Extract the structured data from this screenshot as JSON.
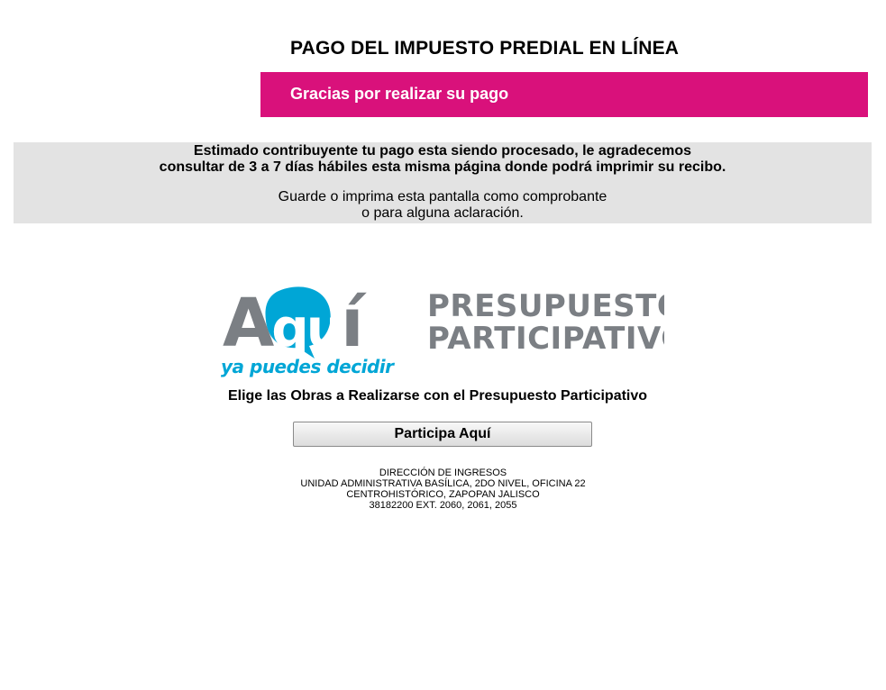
{
  "header": {
    "title": "PAGO DEL IMPUESTO PREDIAL EN LÍNEA",
    "banner_text": "Gracias por realizar su pago",
    "banner_color": "#d9117b"
  },
  "notice": {
    "line1": "Estimado contribuyente tu pago esta siendo procesado, le agradecemos",
    "line2": "consultar de 3 a 7 días hábiles esta misma página donde podrá imprimir su recibo.",
    "line3": "Guarde o imprima esta pantalla como comprobante",
    "line4": "o para alguna aclaración."
  },
  "logo": {
    "word": "Aquí",
    "tagline": "ya puedes decidir",
    "title_line1": "PRESUPUESTO",
    "title_line2": "PARTICIPATIVO",
    "gray": "#7b7f84",
    "blue": "#00a6d6"
  },
  "promo": {
    "heading": "Elige las Obras a Realizarse con el Presupuesto Participativo",
    "button_label": "Participa Aquí"
  },
  "footer": {
    "line1": "DIRECCIÓN DE INGRESOS",
    "line2": "UNIDAD ADMINISTRATIVA BASÍLICA, 2DO NIVEL, OFICINA 22",
    "line3": "CENTROHISTÓRICO, ZAPOPAN JALISCO",
    "line4": "38182200 EXT. 2060, 2061, 2055"
  }
}
